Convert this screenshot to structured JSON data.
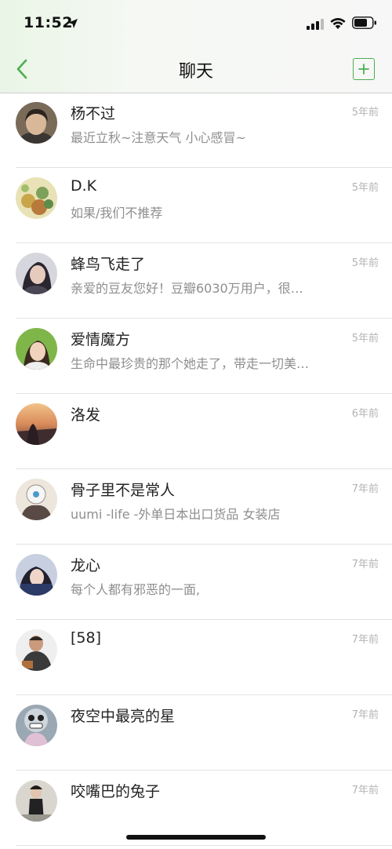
{
  "status_bar": {
    "time": "11:52",
    "icons": [
      "location-arrow-icon",
      "cellular-signal-icon",
      "wifi-icon",
      "battery-icon"
    ]
  },
  "nav": {
    "title": "聊天",
    "back_icon": "chevron-left-icon",
    "add_icon": "plus-square-icon",
    "accent_color": "#4caf50"
  },
  "chats": [
    {
      "name": "杨不过",
      "preview": "最近立秋~注意天气 小心感冒~",
      "time": "5年前"
    },
    {
      "name": "D.K",
      "preview": "如果/我们不推荐",
      "time": "5年前"
    },
    {
      "name": "蜂鸟飞走了",
      "preview": "亲爱的豆友您好！豆瓣6030万用户，很…",
      "time": "5年前"
    },
    {
      "name": "爱情魔方",
      "preview": "生命中最珍贵的那个她走了，带走一切美…",
      "time": "5年前"
    },
    {
      "name": "洛发",
      "preview": "",
      "time": "6年前"
    },
    {
      "name": "骨子里不是常人",
      "preview": "uumi -life -外单日本出口货品 女装店",
      "time": "7年前"
    },
    {
      "name": "龙心",
      "preview": "每个人都有邪恶的一面,",
      "time": "7年前"
    },
    {
      "name": "[58]",
      "preview": "",
      "time": "7年前"
    },
    {
      "name": "夜空中最亮的星",
      "preview": "",
      "time": "7年前"
    },
    {
      "name": "咬嘴巴的兔子",
      "preview": "",
      "time": "7年前"
    }
  ]
}
